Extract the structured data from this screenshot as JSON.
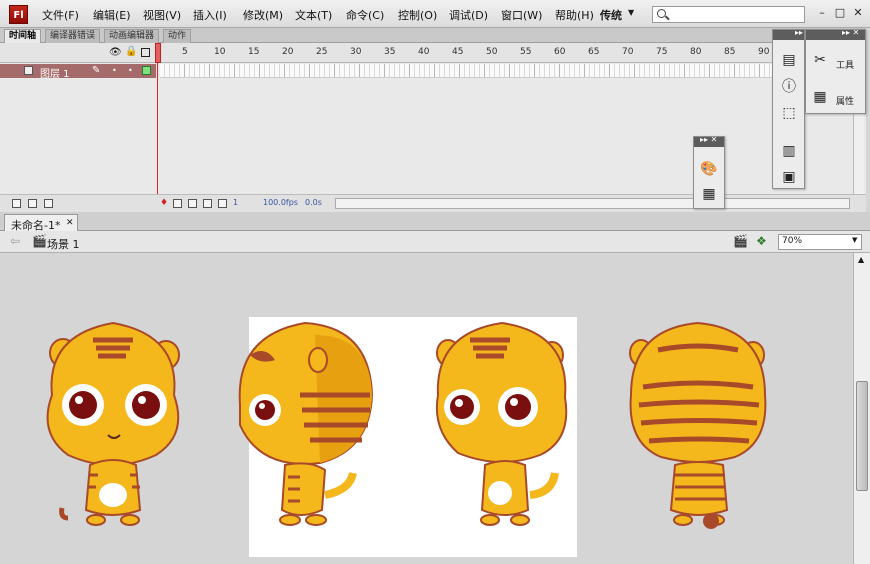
{
  "app": {
    "logo": "Fl",
    "menu": [
      "文件(F)",
      "编辑(E)",
      "视图(V)",
      "插入(I)",
      "修改(M)",
      "文本(T)",
      "命令(C)",
      "控制(O)",
      "调试(D)",
      "窗口(W)",
      "帮助(H)"
    ],
    "workspace_label": "传统",
    "search_placeholder": ""
  },
  "timeline": {
    "tabs": [
      "时间轴",
      "编译器错误",
      "动画编辑器",
      "动作"
    ],
    "frame_ticks": [
      "5",
      "10",
      "15",
      "20",
      "25",
      "30",
      "35",
      "40",
      "45",
      "50",
      "55",
      "60",
      "65",
      "70",
      "75",
      "80",
      "85",
      "90"
    ],
    "layer_name": "图层 1",
    "current_frame": "1",
    "fps": "100.0fps",
    "time": "0.0s"
  },
  "docked_panels": {
    "tools_label": "工具",
    "properties_label": "属性"
  },
  "document": {
    "tab_title": "未命名-1*",
    "scene": "场景 1",
    "zoom": "70%"
  },
  "colors": {
    "accent": "#c2281c",
    "layer_row": "#a56b6b",
    "stage": "#ffffff",
    "tiger_body": "#f5b81c",
    "tiger_stripes": "#a84a2a"
  },
  "icons": [
    "search-icon",
    "eye-icon",
    "lock-icon",
    "outline-icon",
    "pencil-icon",
    "tools-icon",
    "properties-icon",
    "align-icon",
    "info-icon",
    "transform-icon",
    "library-icon",
    "swatches-icon",
    "color-icon",
    "scene-icon",
    "symbol-icon"
  ]
}
